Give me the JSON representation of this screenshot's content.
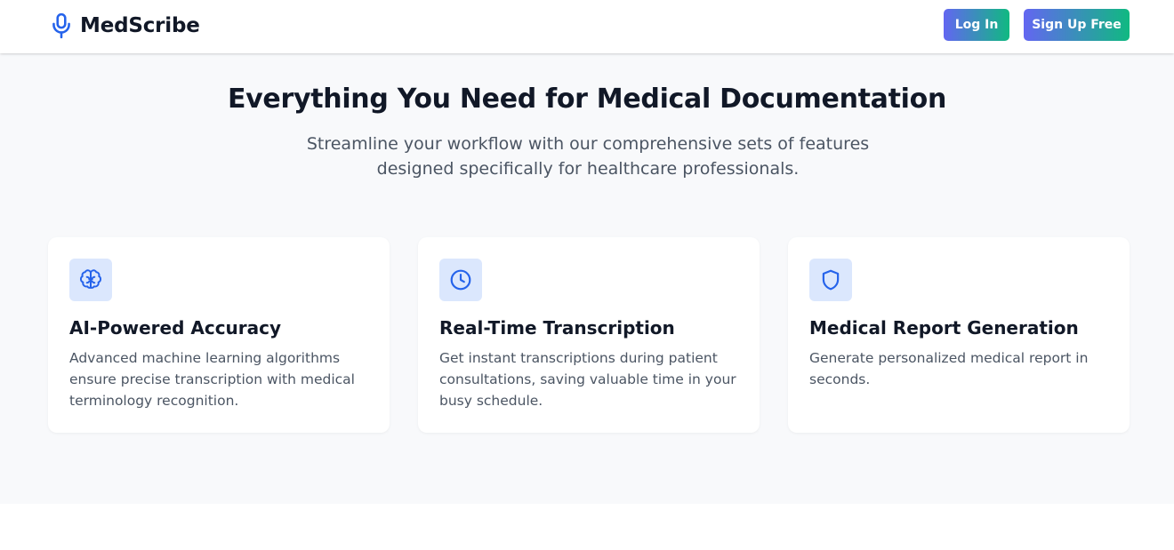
{
  "navbar": {
    "brand_name": "MedScribe",
    "brand_icon": "microphone-icon",
    "login_label": "Log In",
    "signup_label": "Sign Up Free"
  },
  "features": {
    "title": "Everything You Need for Medical Documentation",
    "subtitle": "Streamline your workflow with our comprehensive sets of features designed specifically for healthcare professionals.",
    "cards": [
      {
        "icon": "brain-icon",
        "title": "AI-Powered Accuracy",
        "description": "Advanced machine learning algorithms ensure precise transcription with medical terminology recognition."
      },
      {
        "icon": "clock-icon",
        "title": "Real-Time Transcription",
        "description": "Get instant transcriptions during patient consultations, saving valuable time in your busy schedule."
      },
      {
        "icon": "shield-icon",
        "title": "Medical Report Generation",
        "description": "Generate personalized medical report in seconds."
      }
    ]
  },
  "colors": {
    "accent_blue": "#2563eb",
    "icon_bg": "#dbe7fd",
    "gradient_start": "#6366f1",
    "gradient_end": "#10b981",
    "section_bg": "#f8f9fb"
  }
}
